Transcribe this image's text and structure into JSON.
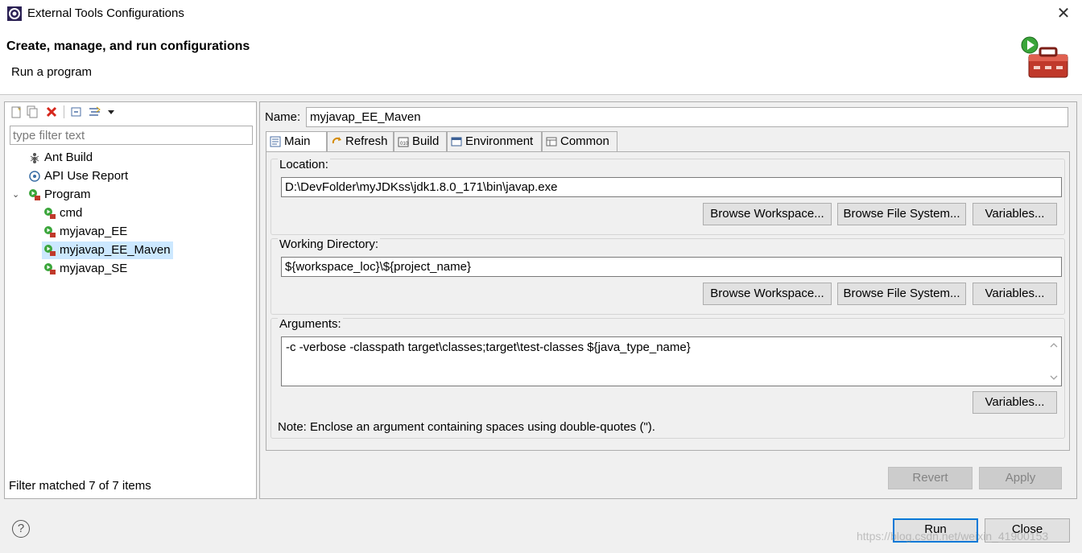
{
  "window": {
    "title": "External Tools Configurations",
    "close_glyph": "✕"
  },
  "header": {
    "title": "Create, manage, and run configurations",
    "subtitle": "Run a program"
  },
  "left_panel": {
    "toolbar_icons": [
      "new-config-icon",
      "duplicate-icon",
      "delete-icon",
      "collapse-all-icon",
      "filter-icon",
      "dropdown-icon"
    ],
    "filter_placeholder": "type filter text",
    "tree": [
      {
        "label": "Ant Build",
        "icon": "ant-icon",
        "level": 0
      },
      {
        "label": "API Use Report",
        "icon": "api-report-icon",
        "level": 0
      },
      {
        "label": "Program",
        "icon": "program-icon",
        "level": 0,
        "expanded": true
      },
      {
        "label": "cmd",
        "icon": "program-config-icon",
        "level": 1
      },
      {
        "label": "myjavap_EE",
        "icon": "program-config-icon",
        "level": 1
      },
      {
        "label": "myjavap_EE_Maven",
        "icon": "program-config-icon",
        "level": 1,
        "selected": true
      },
      {
        "label": "myjavap_SE",
        "icon": "program-config-icon",
        "level": 1
      }
    ],
    "status": "Filter matched 7 of 7 items"
  },
  "right_panel": {
    "name_label": "Name:",
    "name_value": "myjavap_EE_Maven",
    "tabs": [
      {
        "label": "Main",
        "icon": "main-tab-icon",
        "active": true
      },
      {
        "label": "Refresh",
        "icon": "refresh-icon"
      },
      {
        "label": "Build",
        "icon": "build-icon"
      },
      {
        "label": "Environment",
        "icon": "environment-icon"
      },
      {
        "label": "Common",
        "icon": "common-icon"
      }
    ],
    "location": {
      "label": "Location:",
      "value": "D:\\DevFolder\\myJDKss\\jdk1.8.0_171\\bin\\javap.exe",
      "browse_workspace": "Browse Workspace...",
      "browse_fs": "Browse File System...",
      "variables": "Variables..."
    },
    "working_dir": {
      "label": "Working Directory:",
      "value": "${workspace_loc}\\${project_name}",
      "browse_workspace": "Browse Workspace...",
      "browse_fs": "Browse File System...",
      "variables": "Variables..."
    },
    "arguments": {
      "label": "Arguments:",
      "value": "-c -verbose -classpath target\\classes;target\\test-classes ${java_type_name}",
      "variables": "Variables...",
      "note": "Note: Enclose an argument containing spaces using double-quotes (\")."
    },
    "revert": "Revert",
    "apply": "Apply"
  },
  "footer": {
    "run": "Run",
    "close": "Close",
    "watermark": "https://blog.csdn.net/weixin_41900153"
  },
  "colors": {
    "selection": "#cce8ff",
    "default_button_border": "#0078d7",
    "window_bg": "#f0f0f0"
  }
}
